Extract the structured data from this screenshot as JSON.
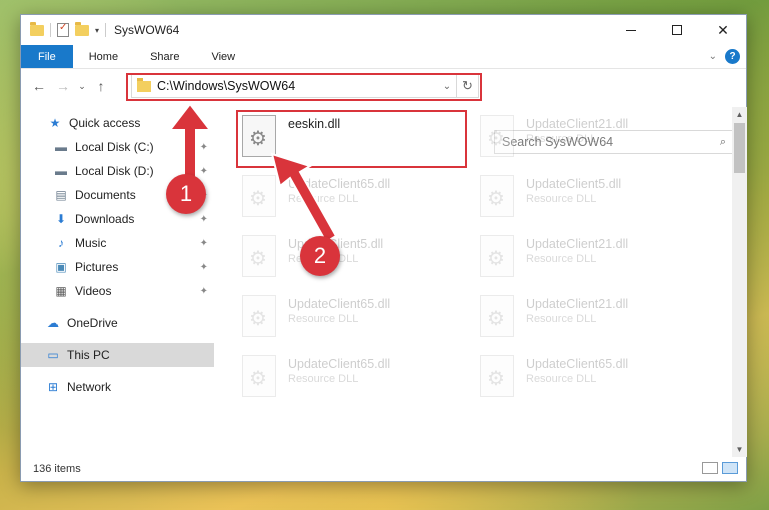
{
  "window": {
    "title": "SysWOW64",
    "minimize": "—",
    "maximize": "",
    "close": "✕"
  },
  "ribbon": {
    "tabs": [
      "File",
      "Home",
      "Share",
      "View"
    ],
    "collapse_glyph": "⌄",
    "help_glyph": "?"
  },
  "nav": {
    "back": "←",
    "forward": "→",
    "recent": "⌄",
    "up": "↑"
  },
  "address": {
    "path": "C:\\Windows\\SysWOW64",
    "dropdown": "⌄",
    "refresh": "↻"
  },
  "search": {
    "placeholder": "Search SysWOW64",
    "icon_glyph": "⌕"
  },
  "sidebar": {
    "items": [
      {
        "label": "Quick access",
        "icon": "star-icon",
        "glyph": "★",
        "color": "#2b7cd3",
        "pinned": false
      },
      {
        "label": "Local Disk (C:)",
        "icon": "drive-icon",
        "glyph": "▬",
        "color": "#6a7b8c",
        "pinned": true
      },
      {
        "label": "Local Disk (D:)",
        "icon": "drive-icon",
        "glyph": "▬",
        "color": "#6a7b8c",
        "pinned": true
      },
      {
        "label": "Documents",
        "icon": "documents-icon",
        "glyph": "▤",
        "color": "#6a7b8c",
        "pinned": true
      },
      {
        "label": "Downloads",
        "icon": "download-icon",
        "glyph": "⬇",
        "color": "#2b7cd3",
        "pinned": true
      },
      {
        "label": "Music",
        "icon": "music-icon",
        "glyph": "♪",
        "color": "#2b7cd3",
        "pinned": true
      },
      {
        "label": "Pictures",
        "icon": "pictures-icon",
        "glyph": "▣",
        "color": "#4a8ab8",
        "pinned": true
      },
      {
        "label": "Videos",
        "icon": "videos-icon",
        "glyph": "▦",
        "color": "#5a5a5a",
        "pinned": true
      },
      {
        "label": "OneDrive",
        "icon": "cloud-icon",
        "glyph": "☁",
        "color": "#2b7cd3",
        "pinned": false
      },
      {
        "label": "This PC",
        "icon": "computer-icon",
        "glyph": "▭",
        "color": "#2b7cd3",
        "pinned": false
      },
      {
        "label": "Network",
        "icon": "network-icon",
        "glyph": "⊞",
        "color": "#2b7cd3",
        "pinned": false
      }
    ],
    "pin_glyph": "✦"
  },
  "files": [
    {
      "name": "eeskin.dll",
      "type": "",
      "highlighted": true
    },
    {
      "name": "UpdateClient21.dll",
      "type": "Resource DLL"
    },
    {
      "name": "UpdateClient65.dll",
      "type": "Resource DLL"
    },
    {
      "name": "UpdateClient5.dll",
      "type": "Resource DLL"
    },
    {
      "name": "UpdateClient5.dll",
      "type": "Resource DLL"
    },
    {
      "name": "UpdateClient21.dll",
      "type": "Resource DLL"
    },
    {
      "name": "UpdateClient65.dll",
      "type": "Resource DLL"
    },
    {
      "name": "UpdateClient21.dll",
      "type": "Resource DLL"
    },
    {
      "name": "UpdateClient65.dll",
      "type": "Resource DLL"
    },
    {
      "name": "UpdateClient65.dll",
      "type": "Resource DLL"
    }
  ],
  "status": {
    "item_count": "136 items"
  },
  "callouts": [
    {
      "number": "1"
    },
    {
      "number": "2"
    }
  ],
  "colors": {
    "accent": "#1979ca",
    "callout": "#d9343b"
  }
}
